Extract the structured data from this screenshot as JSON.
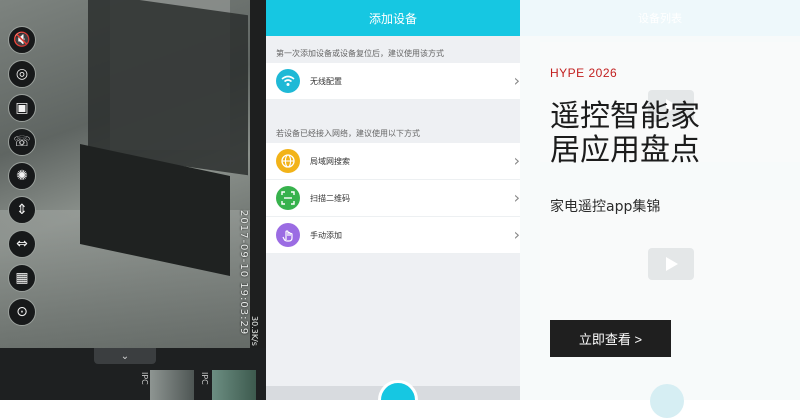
{
  "camera": {
    "timestamp": "2017-09-10 19:03:29",
    "bitrate": "30.3K/s",
    "collapse_icon": "chevron-down-icon",
    "thumbnails": [
      "IPC",
      "IPC"
    ],
    "tools": [
      {
        "name": "mute-icon",
        "glyph": "🔇"
      },
      {
        "name": "snapshot-icon",
        "glyph": "◎"
      },
      {
        "name": "record-icon",
        "glyph": "▣"
      },
      {
        "name": "intercom-icon",
        "glyph": "☏"
      },
      {
        "name": "light-icon",
        "glyph": "✺"
      },
      {
        "name": "flip-vertical-icon",
        "glyph": "⇕"
      },
      {
        "name": "flip-horizontal-icon",
        "glyph": "⇔"
      },
      {
        "name": "grid-icon",
        "glyph": "▦"
      },
      {
        "name": "focus-icon",
        "glyph": "⊙"
      }
    ]
  },
  "add_device": {
    "title": "添加设备",
    "hint_first": "第一次添加设备或设备复位后，建议使用该方式",
    "hint_second": "若设备已经接入网络，建议使用以下方式",
    "wireless": {
      "label": "无线配置",
      "icon": "wifi-icon",
      "color": "#1fb9d6"
    },
    "options": [
      {
        "label": "局域网搜索",
        "icon": "globe-icon",
        "color": "#f2b319"
      },
      {
        "label": "扫描二维码",
        "icon": "qr-scan-icon",
        "color": "#37b24d"
      },
      {
        "label": "手动添加",
        "icon": "hand-icon",
        "color": "#9b6ce3"
      }
    ],
    "accent": "#16c7e2"
  },
  "ad": {
    "tag": "HYPE 2026",
    "title": "遥控智能家居应用盘点",
    "subtitle": "家电遥控app集锦",
    "button": "立即查看 >",
    "tag_color": "#c21f1f",
    "background_header": "设备列表"
  }
}
